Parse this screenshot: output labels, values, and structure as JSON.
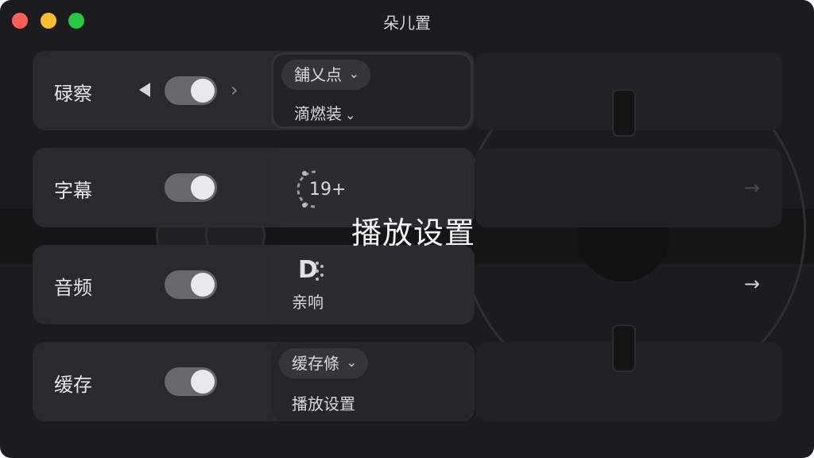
{
  "window": {
    "title": "朵儿置"
  },
  "rows": [
    {
      "label": "碌察",
      "toggle_on": true
    },
    {
      "label": "字幕",
      "toggle_on": true
    },
    {
      "label": "音频",
      "toggle_on": true
    },
    {
      "label": "缓存",
      "toggle_on": true
    }
  ],
  "nav": {
    "prev_icon": "◀",
    "next_icon": "›"
  },
  "sub_panels": {
    "row1": {
      "pill": "舗乂点",
      "second": "滴燃装"
    },
    "row2": {
      "rating": "19+"
    },
    "row3": {
      "logo": "D",
      "label": "亲响"
    },
    "row4": {
      "pill": "缓存條",
      "second": "播放设置"
    }
  },
  "overlay": {
    "title": "播放设置"
  },
  "side_arrows": {
    "top": "→",
    "bottom": "→"
  },
  "colors": {
    "window_bg": "#1c1c1e",
    "row_bg": "#2a2a2c",
    "toggle_on": "#68686c",
    "traffic_red": "#ff5f57",
    "traffic_yellow": "#febc2e",
    "traffic_green": "#28c840"
  }
}
